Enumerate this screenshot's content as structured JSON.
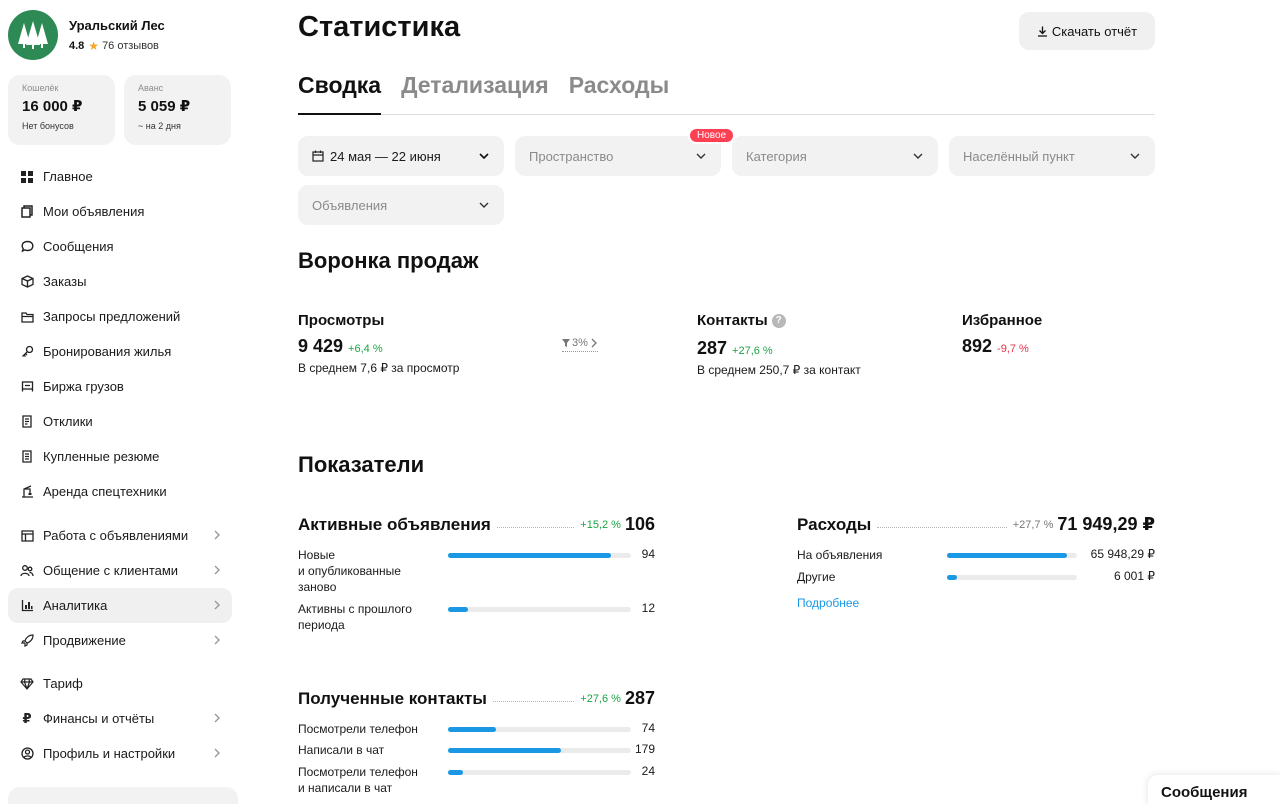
{
  "profile": {
    "name": "Уральский Лес",
    "rating": "4.8",
    "reviews": "76 отзывов"
  },
  "wallets": [
    {
      "label": "Кошелёк",
      "amount": "16 000 ₽",
      "sub": "Нет бонусов"
    },
    {
      "label": "Аванс",
      "amount": "5 059 ₽",
      "sub": "~ на 2 дня"
    }
  ],
  "nav": [
    {
      "label": "Главное",
      "icon": "grid-icon"
    },
    {
      "label": "Мои объявления",
      "icon": "copy-icon"
    },
    {
      "label": "Сообщения",
      "icon": "chat-bubble-icon"
    },
    {
      "label": "Заказы",
      "icon": "box-icon"
    },
    {
      "label": "Запросы предложений",
      "icon": "folder-icon"
    },
    {
      "label": "Бронирования жилья",
      "icon": "key-icon"
    },
    {
      "label": "Биржа грузов",
      "icon": "truck-icon"
    },
    {
      "label": "Отклики",
      "icon": "document-icon"
    },
    {
      "label": "Купленные резюме",
      "icon": "resume-icon"
    },
    {
      "label": "Аренда спецтехники",
      "icon": "crane-icon"
    }
  ],
  "nav_groups": [
    {
      "label": "Работа с объявлениями",
      "icon": "listings-icon"
    },
    {
      "label": "Общение с клиентами",
      "icon": "people-icon"
    },
    {
      "label": "Аналитика",
      "icon": "chart-icon"
    },
    {
      "label": "Продвижение",
      "icon": "rocket-icon"
    }
  ],
  "nav_bottom": [
    {
      "label": "Тариф",
      "icon": "diamond-icon"
    },
    {
      "label": "Финансы и отчёты",
      "icon": "ruble-icon"
    },
    {
      "label": "Профиль и настройки",
      "icon": "user-circle-icon"
    }
  ],
  "header": {
    "title": "Статистика",
    "download": "Скачать отчёт"
  },
  "tabs": [
    "Сводка",
    "Детализация",
    "Расходы"
  ],
  "filters": {
    "date": "24 мая — 22 июня",
    "space": "Пространство",
    "space_badge": "Новое",
    "category": "Категория",
    "locality": "Населённый пункт",
    "ads": "Объявления"
  },
  "funnel": {
    "title": "Воронка продаж",
    "views": {
      "label": "Просмотры",
      "value": "9 429",
      "pct": "+6,4 %",
      "sub": "В среднем 7,6 ₽ за просмотр"
    },
    "conversion": "3%",
    "contacts": {
      "label": "Контакты",
      "value": "287",
      "pct": "+27,6 %",
      "sub": "В среднем 250,7 ₽ за контакт"
    },
    "favorites": {
      "label": "Избранное",
      "value": "892",
      "pct": "-9,7 %"
    }
  },
  "indicators": {
    "title": "Показатели",
    "active_ads": {
      "title": "Активные объявления",
      "pct": "+15,2 %",
      "value": "106",
      "rows": [
        {
          "label": "Новые\nи опубликованные\nзаново",
          "value": "94",
          "fraction": 0.89
        },
        {
          "label": "Активны с прошлого\nпериода",
          "value": "12",
          "fraction": 0.11
        }
      ]
    },
    "expenses": {
      "title": "Расходы",
      "pct": "+27,7 %",
      "value": "71 949,29 ₽",
      "rows": [
        {
          "label": "На объявления",
          "value": "65 948,29 ₽",
          "fraction": 0.92
        },
        {
          "label": "Другие",
          "value": "6 001 ₽",
          "fraction": 0.08
        }
      ],
      "more": "Подробнее"
    },
    "contacts": {
      "title": "Полученные контакты",
      "pct": "+27,6 %",
      "value": "287",
      "rows": [
        {
          "label": "Посмотрели телефон",
          "value": "74",
          "fraction": 0.26
        },
        {
          "label": "Написали в чат",
          "value": "179",
          "fraction": 0.62
        },
        {
          "label": "Посмотрели телефон\nи написали в чат",
          "value": "24",
          "fraction": 0.08
        }
      ]
    }
  },
  "chat_tab": "Сообщения",
  "colors": {
    "accent": "#1a98e4",
    "up": "#1aa542",
    "down": "#e8334a",
    "badge": "#ff4053",
    "avatar": "#2e8a55"
  }
}
